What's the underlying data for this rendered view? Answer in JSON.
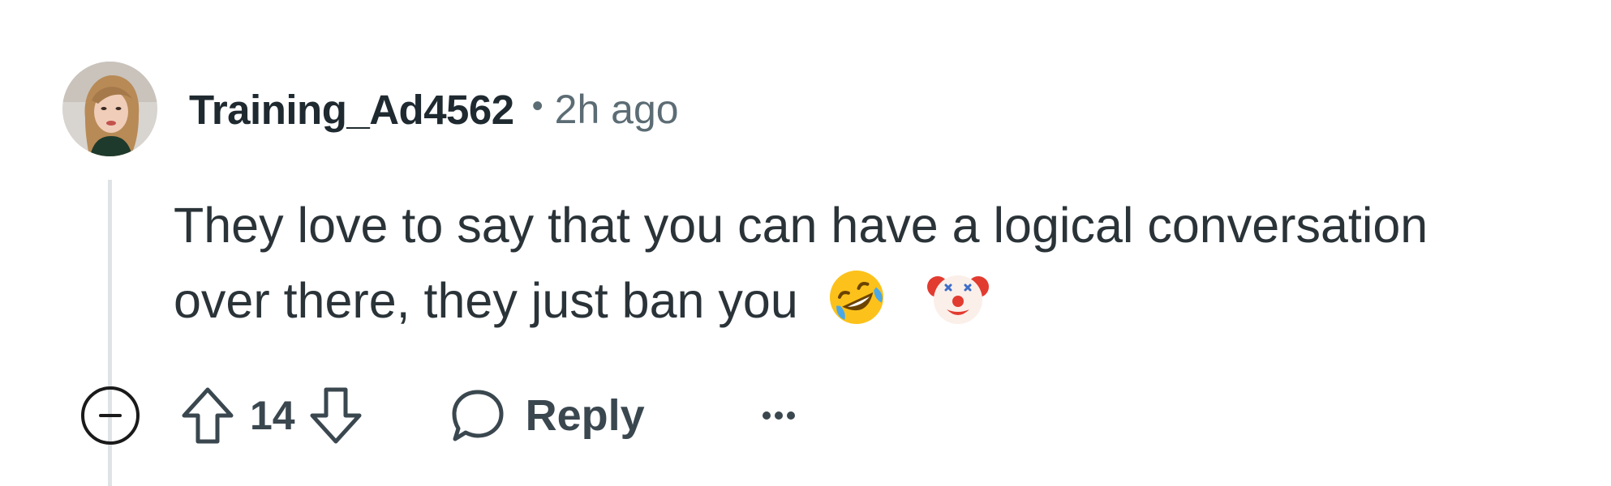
{
  "comment": {
    "author": "Training_Ad4562",
    "separator": "•",
    "time": "2h ago",
    "body": "They love to say that you can have a logical conversation over there, they just ban you",
    "emojis": [
      "rolling-on-floor-laughing-emoji",
      "clown-face-emoji"
    ]
  },
  "actions": {
    "score": "14",
    "reply_label": "Reply"
  },
  "colors": {
    "text_primary": "#1f2a30",
    "text_secondary": "#5c6c74",
    "icon": "#3a474f",
    "thread_line": "#dfe3e5"
  }
}
